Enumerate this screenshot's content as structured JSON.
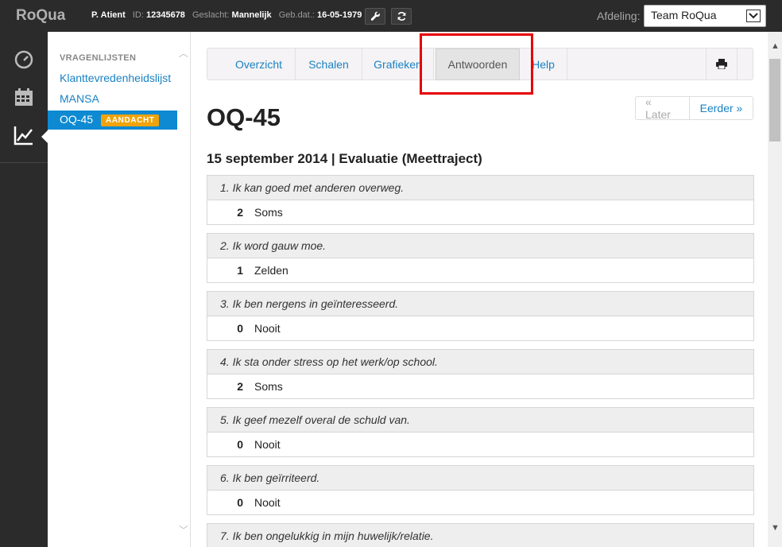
{
  "app": {
    "brand": "RoQua"
  },
  "patient": {
    "name": "P. Atient",
    "id_label": "ID:",
    "id": "12345678",
    "gender_label": "Geslacht:",
    "gender": "Mannelijk",
    "dob_label": "Geb.dat.:",
    "dob": "16-05-1979"
  },
  "toolbar_icons": [
    "wrench-icon",
    "refresh-icon"
  ],
  "department": {
    "label": "Afdeling:",
    "selected": "Team RoQua"
  },
  "rail": {
    "icons": [
      "dashboard-icon",
      "calendar-icon",
      "chart-icon"
    ]
  },
  "sidebar": {
    "heading": "VRAGENLIJSTEN",
    "items": [
      {
        "label": "Klanttevredenheidslijst"
      },
      {
        "label": "MANSA"
      },
      {
        "label": "OQ-45",
        "badge": "AANDACHT",
        "active": true
      }
    ]
  },
  "tabs": [
    {
      "label": "Overzicht"
    },
    {
      "label": "Schalen"
    },
    {
      "label": "Grafieken"
    },
    {
      "label": "Antwoorden",
      "active": true
    },
    {
      "label": "Help"
    }
  ],
  "page": {
    "title": "OQ-45",
    "prev_label": "« Later",
    "next_label": "Eerder »",
    "subtitle": "15 september 2014 | Evaluatie (Meettraject)"
  },
  "questions": [
    {
      "text": "1. Ik kan goed met anderen overweg.",
      "score": "2",
      "answer": "Soms"
    },
    {
      "text": "2. Ik word gauw moe.",
      "score": "1",
      "answer": "Zelden"
    },
    {
      "text": "3. Ik ben nergens in geïnteresseerd.",
      "score": "0",
      "answer": "Nooit"
    },
    {
      "text": "4. Ik sta onder stress op het werk/op school.",
      "score": "2",
      "answer": "Soms"
    },
    {
      "text": "5. Ik geef mezelf overal de schuld van.",
      "score": "0",
      "answer": "Nooit"
    },
    {
      "text": "6. Ik ben geïrriteerd.",
      "score": "0",
      "answer": "Nooit"
    },
    {
      "text": "7. Ik ben ongelukkig in mijn huwelijk/relatie.",
      "score": "",
      "answer": ""
    }
  ],
  "colors": {
    "accent": "#0e8ad2",
    "badge": "#f0a30a",
    "highlight": "#e60000",
    "topbar": "#2b2b2b"
  }
}
